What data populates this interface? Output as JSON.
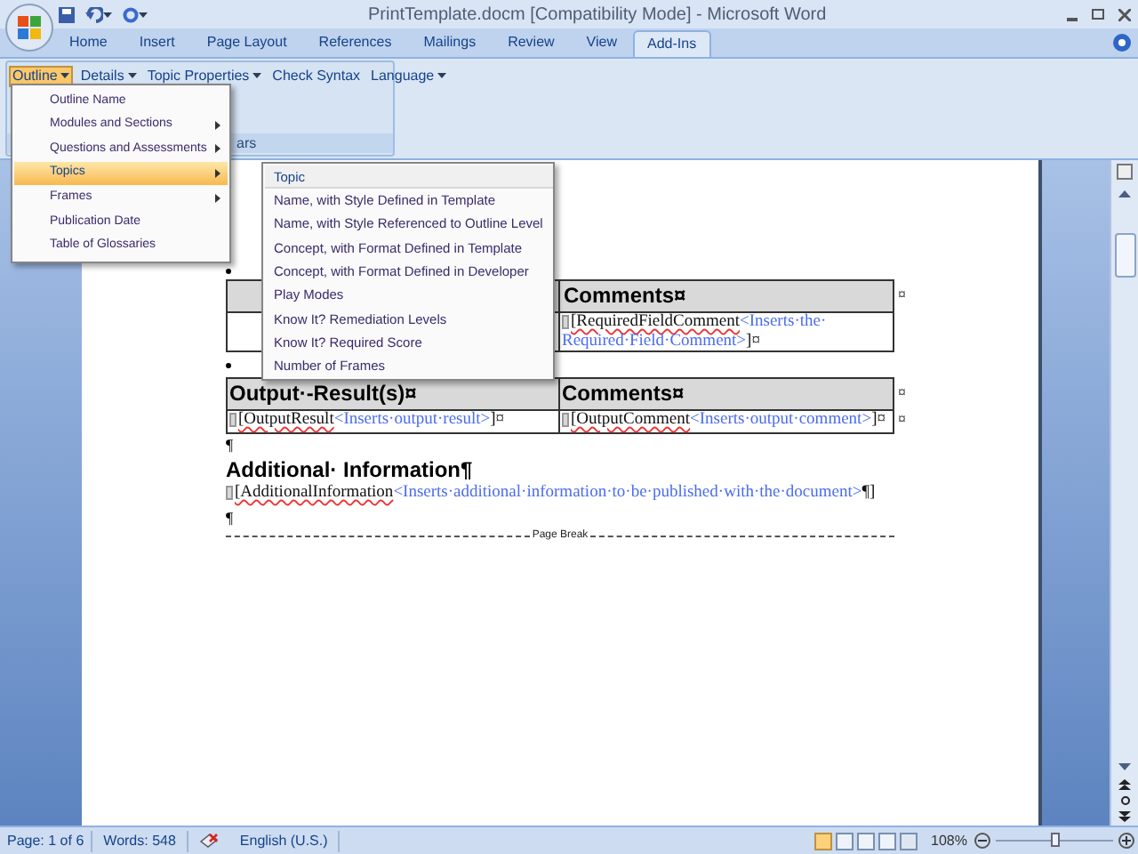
{
  "window": {
    "title": "PrintTemplate.docm [Compatibility Mode] - Microsoft Word"
  },
  "tabs": [
    {
      "label": "Home",
      "selected": false
    },
    {
      "label": "Insert",
      "selected": false
    },
    {
      "label": "Page Layout",
      "selected": false
    },
    {
      "label": "References",
      "selected": false
    },
    {
      "label": "Mailings",
      "selected": false
    },
    {
      "label": "Review",
      "selected": false
    },
    {
      "label": "View",
      "selected": false
    },
    {
      "label": "Add-Ins",
      "selected": true
    }
  ],
  "toolbar": [
    {
      "label": "Outline",
      "dropdown": true,
      "pressed": true
    },
    {
      "label": "Details",
      "dropdown": true,
      "pressed": false
    },
    {
      "label": "Topic Properties",
      "dropdown": true,
      "pressed": false
    },
    {
      "label": "Check Syntax",
      "dropdown": false,
      "pressed": false
    },
    {
      "label": "Language",
      "dropdown": true,
      "pressed": false
    }
  ],
  "ribbon_group": {
    "label": "ars"
  },
  "outline_menu": [
    {
      "label": "Outline Name",
      "submenu": false,
      "selected": false
    },
    {
      "label": "Modules and Sections",
      "submenu": true,
      "selected": false
    },
    {
      "label": "Questions and Assessments",
      "submenu": true,
      "selected": false
    },
    {
      "label": "Topics",
      "submenu": true,
      "selected": true
    },
    {
      "label": "Frames",
      "submenu": true,
      "selected": false
    },
    {
      "label": "Publication Date",
      "submenu": false,
      "selected": false
    },
    {
      "label": "Table of Glossaries",
      "submenu": false,
      "selected": false
    }
  ],
  "topics_submenu": {
    "header": "Topic",
    "items": [
      "Name, with Style Defined in Template",
      "Name, with Style Referenced to Outline Level",
      "Concept, with Format Defined in Template",
      "Concept, with Format Defined in Developer",
      "Play Modes",
      "Know It? Remediation Levels",
      "Know It? Required Score",
      "Number of Frames"
    ]
  },
  "document": {
    "table_1": {
      "header": "Comments¤",
      "row_end": "¤",
      "cell": {
        "open": "[RequiredFieldComment",
        "hint": "<Inserts·the·Required·Field·Comment>",
        "close": "]¤"
      }
    },
    "table_2": {
      "headers": [
        "Output·-Result(s)¤",
        "Comments¤"
      ],
      "row_end": "¤",
      "cells": [
        {
          "open": "[OutputResult",
          "hint": "<Inserts·output·result>",
          "close": "]¤"
        },
        {
          "open": "[OutputComment",
          "hint": "<Inserts·output·comment>",
          "close": "]¤"
        }
      ]
    },
    "mark_1": "¶",
    "heading": "Additional· Information¶",
    "field_line": {
      "open": "[AdditionalInformation",
      "hint": "<Inserts·additional·information·to·be·published·with·the·document>",
      "close": "¶]"
    },
    "mark_2": "¶",
    "page_break": "Page Break"
  },
  "status_bar": {
    "page": "Page: 1 of 6",
    "words": "Words: 548",
    "language": "English (U.S.)",
    "zoom": "108%"
  }
}
